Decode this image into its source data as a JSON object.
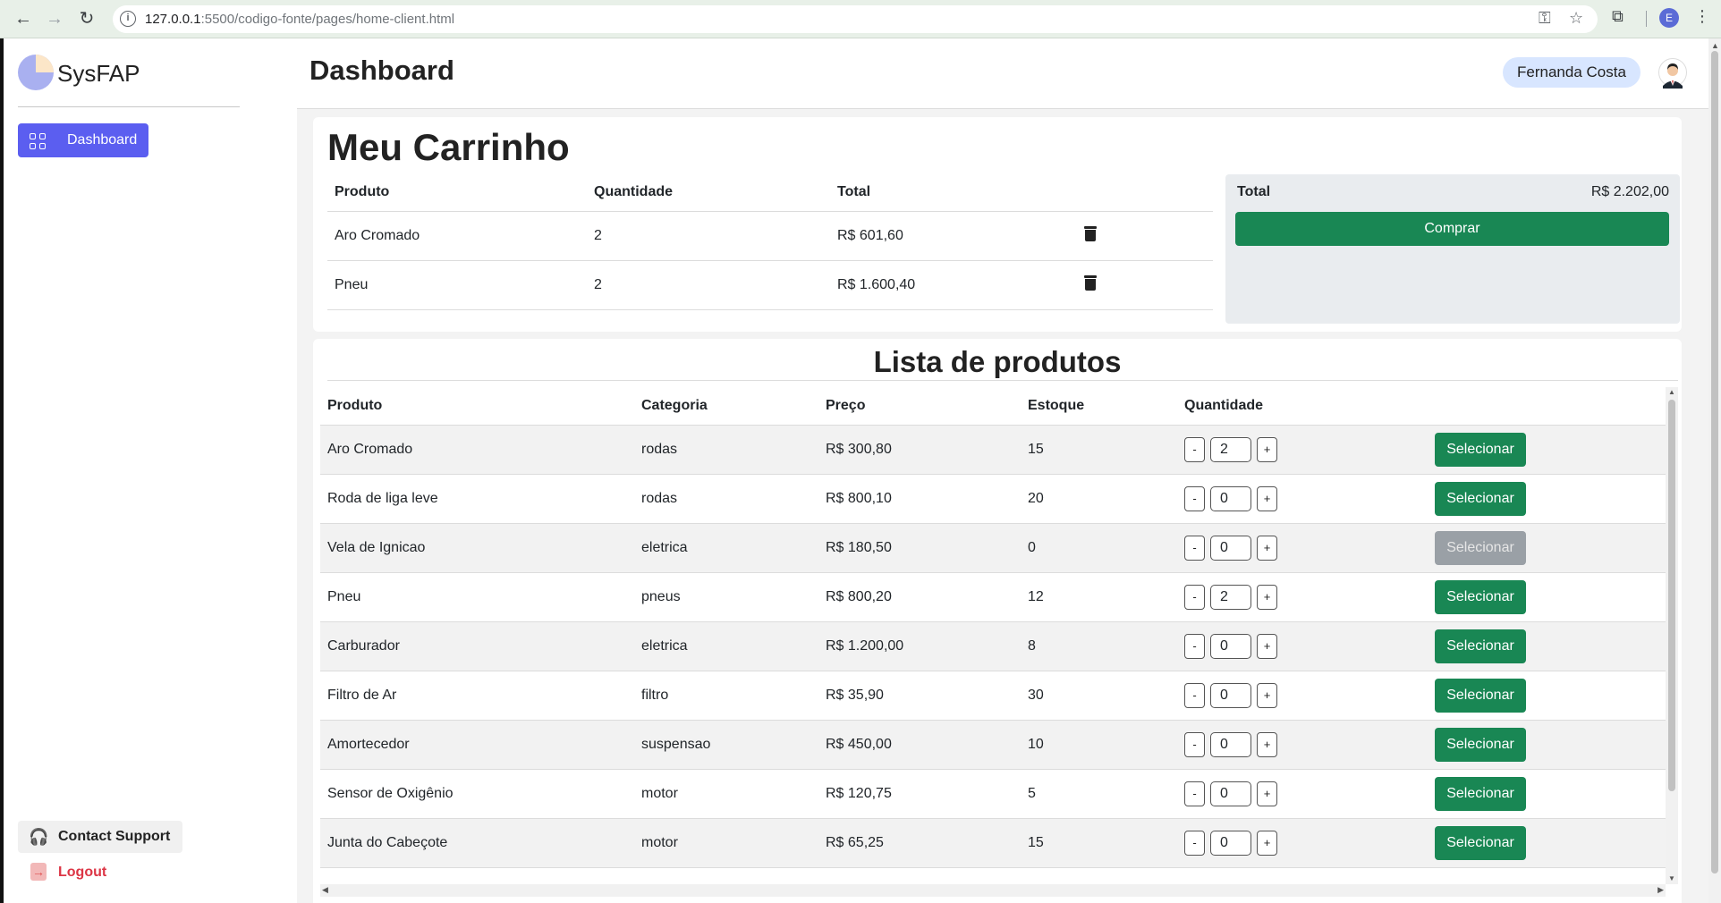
{
  "browser": {
    "url_host": "127.0.0.1",
    "url_rest": ":5500/codigo-fonte/pages/home-client.html",
    "profile_initial": "E"
  },
  "sidebar": {
    "brand": "SysFAP",
    "items": [
      {
        "label": "Dashboard"
      }
    ],
    "support_label": "Contact Support",
    "logout_label": "Logout"
  },
  "header": {
    "title": "Dashboard",
    "user_name": "Fernanda Costa"
  },
  "cart": {
    "title": "Meu Carrinho",
    "columns": [
      "Produto",
      "Quantidade",
      "Total"
    ],
    "rows": [
      {
        "produto": "Aro Cromado",
        "quantidade": "2",
        "total": "R$ 601,60"
      },
      {
        "produto": "Pneu",
        "quantidade": "2",
        "total": "R$ 1.600,40"
      }
    ],
    "summary_label": "Total",
    "summary_value": "R$ 2.202,00",
    "buy_label": "Comprar"
  },
  "products": {
    "title": "Lista de produtos",
    "columns": [
      "Produto",
      "Categoria",
      "Preço",
      "Estoque",
      "Quantidade"
    ],
    "select_label": "Selecionar",
    "rows": [
      {
        "produto": "Aro Cromado",
        "categoria": "rodas",
        "preco": "R$ 300,80",
        "estoque": "15",
        "quantidade": "2",
        "disabled": false
      },
      {
        "produto": "Roda de liga leve",
        "categoria": "rodas",
        "preco": "R$ 800,10",
        "estoque": "20",
        "quantidade": "0",
        "disabled": false
      },
      {
        "produto": "Vela de Ignicao",
        "categoria": "eletrica",
        "preco": "R$ 180,50",
        "estoque": "0",
        "quantidade": "0",
        "disabled": true
      },
      {
        "produto": "Pneu",
        "categoria": "pneus",
        "preco": "R$ 800,20",
        "estoque": "12",
        "quantidade": "2",
        "disabled": false
      },
      {
        "produto": "Carburador",
        "categoria": "eletrica",
        "preco": "R$ 1.200,00",
        "estoque": "8",
        "quantidade": "0",
        "disabled": false
      },
      {
        "produto": "Filtro de Ar",
        "categoria": "filtro",
        "preco": "R$ 35,90",
        "estoque": "30",
        "quantidade": "0",
        "disabled": false
      },
      {
        "produto": "Amortecedor",
        "categoria": "suspensao",
        "preco": "R$ 450,00",
        "estoque": "10",
        "quantidade": "0",
        "disabled": false
      },
      {
        "produto": "Sensor de Oxigênio",
        "categoria": "motor",
        "preco": "R$ 120,75",
        "estoque": "5",
        "quantidade": "0",
        "disabled": false
      },
      {
        "produto": "Junta do Cabeçote",
        "categoria": "motor",
        "preco": "R$ 65,25",
        "estoque": "15",
        "quantidade": "0",
        "disabled": false
      }
    ]
  },
  "colors": {
    "primary": "#5b5ef0",
    "success": "#198754",
    "disabled": "#9aa0a6",
    "danger": "#dc3545"
  }
}
